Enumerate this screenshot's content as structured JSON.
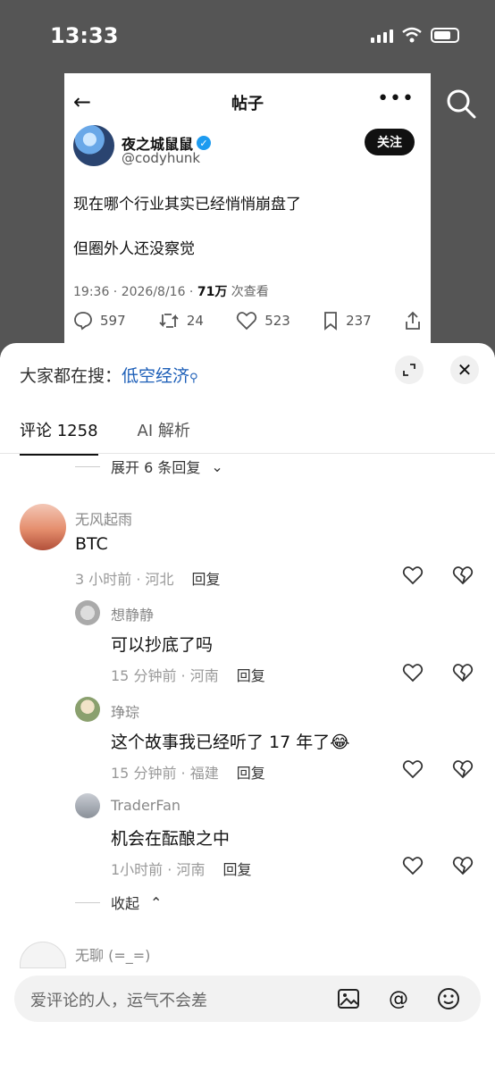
{
  "status": {
    "time": "13:33"
  },
  "tweet": {
    "header_title": "帖子",
    "author_name": "夜之城鼠鼠",
    "handle": "@codyhunk",
    "follow_label": "关注",
    "line1": "现在哪个行业其实已经悄悄崩盘了",
    "line2": "但圈外人还没察觉",
    "meta_prefix": "19:36 · 2026/8/16 · ",
    "views": "71万",
    "views_suffix": " 次查看",
    "replies": "597",
    "retweets": "24",
    "likes": "523",
    "bookmarks": "237"
  },
  "sheet": {
    "search_prefix": "大家都在搜：",
    "search_term": "低空经济",
    "tabs": [
      {
        "label": "评论 1258"
      },
      {
        "label": "AI 解析"
      }
    ],
    "expand_label": "展开 6 条回复",
    "collapse_label": "收起",
    "comments": [
      {
        "user": "无风起雨",
        "text": "BTC",
        "time": "3 小时前 · 河北",
        "reply": "回复"
      },
      {
        "user": "想静静",
        "text": "可以抄底了吗",
        "time": "15 分钟前 · 河南",
        "reply": "回复"
      },
      {
        "user": "琤琮",
        "text": "这个故事我已经听了 17 年了😂",
        "time": "15 分钟前 · 福建",
        "reply": "回复"
      },
      {
        "user": "TraderFan",
        "text": "机会在酝酿之中",
        "time": "1小时前 · 河南",
        "reply": "回复"
      },
      {
        "user": "无聊 (=_=)"
      }
    ],
    "input_placeholder": "爱评论的人，运气不会差"
  }
}
